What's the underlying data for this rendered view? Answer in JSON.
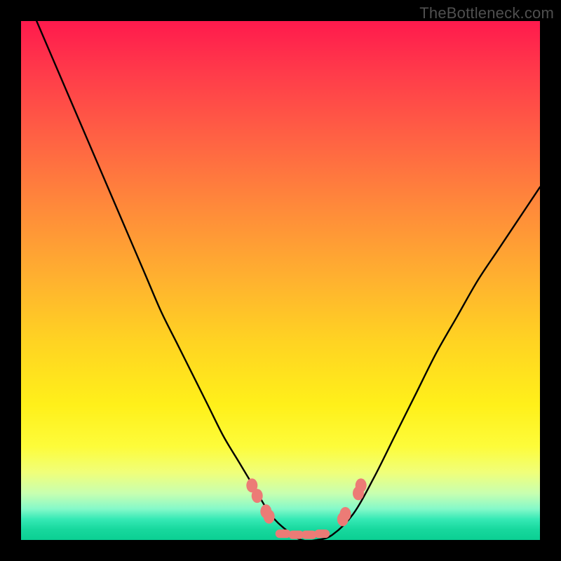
{
  "watermark": {
    "text": "TheBottleneck.com"
  },
  "chart_data": {
    "type": "line",
    "title": "",
    "xlabel": "",
    "ylabel": "",
    "xlim": [
      0,
      1
    ],
    "ylim": [
      0,
      1
    ],
    "legend": false,
    "grid": false,
    "background_gradient": {
      "direction": "vertical",
      "stops": [
        {
          "pos": 0.0,
          "color": "#ff1a4d"
        },
        {
          "pos": 0.5,
          "color": "#ffb22f"
        },
        {
          "pos": 0.8,
          "color": "#fff01a"
        },
        {
          "pos": 0.95,
          "color": "#85f9c9"
        },
        {
          "pos": 1.0,
          "color": "#0bcf93"
        }
      ]
    },
    "series": [
      {
        "name": "bottleneck-curve",
        "type": "line",
        "color": "#000000",
        "x": [
          0.03,
          0.06,
          0.09,
          0.12,
          0.15,
          0.18,
          0.21,
          0.24,
          0.27,
          0.3,
          0.33,
          0.36,
          0.39,
          0.42,
          0.45,
          0.48,
          0.51,
          0.54,
          0.57,
          0.6,
          0.64,
          0.68,
          0.72,
          0.76,
          0.8,
          0.84,
          0.88,
          0.92,
          0.96,
          1.0
        ],
        "y": [
          1.0,
          0.93,
          0.86,
          0.79,
          0.72,
          0.65,
          0.58,
          0.51,
          0.44,
          0.38,
          0.32,
          0.26,
          0.2,
          0.15,
          0.1,
          0.05,
          0.02,
          0.0,
          0.0,
          0.01,
          0.05,
          0.12,
          0.2,
          0.28,
          0.36,
          0.43,
          0.5,
          0.56,
          0.62,
          0.68
        ]
      },
      {
        "name": "markers-left",
        "type": "scatter",
        "color": "#ec7b76",
        "x": [
          0.445,
          0.455,
          0.472,
          0.478
        ],
        "y": [
          0.105,
          0.085,
          0.055,
          0.045
        ]
      },
      {
        "name": "markers-bottom",
        "type": "scatter",
        "color": "#ec7b76",
        "shape": "capsule",
        "x": [
          0.505,
          0.53,
          0.555,
          0.58
        ],
        "y": [
          0.012,
          0.01,
          0.01,
          0.012
        ]
      },
      {
        "name": "markers-right",
        "type": "scatter",
        "color": "#ec7b76",
        "x": [
          0.62,
          0.625,
          0.65,
          0.655
        ],
        "y": [
          0.04,
          0.05,
          0.09,
          0.105
        ]
      }
    ]
  }
}
